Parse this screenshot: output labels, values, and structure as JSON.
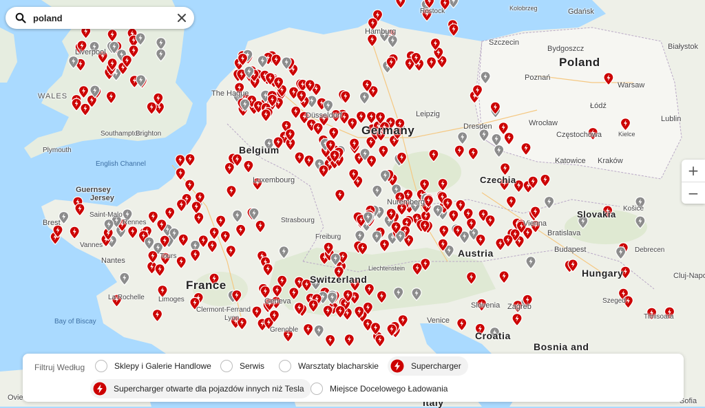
{
  "search": {
    "value": "poland",
    "placeholder": ""
  },
  "map": {
    "zoom_in_label": "+",
    "zoom_out_label": "−",
    "colors": {
      "sea": "#aadaff",
      "land": "#eef0e8",
      "supercharger": "#cc0000",
      "service": "#8c8c8c",
      "highlight_country": "#f6f6f2"
    },
    "labels": {
      "countries": [
        "Poland",
        "Germany",
        "France",
        "Belgium",
        "Czechia",
        "Slovakia",
        "Austria",
        "Hungary",
        "Switzerland",
        "Croatia",
        "Bosnia and",
        "Italy"
      ],
      "regions": [
        "WALES"
      ],
      "seas": [
        "English Channel",
        "Bay of Biscay"
      ],
      "cities": [
        "Liverpool",
        "The Hague",
        "Hamburg",
        "Szczecin",
        "Bydgoszcz",
        "Białystok",
        "Gdańsk",
        "Kolobrzeg",
        "Rostock",
        "Poznań",
        "Warsaw",
        "Łódź",
        "Lublin",
        "Częstochowa",
        "Kielce",
        "Katowice",
        "Kraków",
        "Wrocław",
        "Dresden",
        "Leipzig",
        "Düsseldorf",
        "Southampton",
        "Brighton",
        "Plymouth",
        "Guernsey",
        "Jersey",
        "Luxembourg",
        "Strasbourg",
        "Nuremberg",
        "Bratislava",
        "Budapest",
        "Košice",
        "Debrecen",
        "Cluj-Napoc",
        "Szeged",
        "Timisoara",
        "Zagreb",
        "Venice",
        "Geneva",
        "Grenoble",
        "Limoges",
        "Clermont-Ferrand",
        "La Rochelle",
        "Nantes",
        "Tours",
        "Rennes",
        "Freiburg",
        "Liechtenstein",
        "Lyon",
        "Slovenia",
        "Vienna",
        "Oviedo",
        "Sofia",
        "Brest",
        "Saint-Malo",
        "Vannes"
      ]
    }
  },
  "filter": {
    "title": "Filtruj Według",
    "options": [
      {
        "label": "Sklepy i Galerie Handlowe",
        "selected": false
      },
      {
        "label": "Serwis",
        "selected": false
      },
      {
        "label": "Warsztaty blacharskie",
        "selected": false
      },
      {
        "label": "Supercharger",
        "selected": true
      },
      {
        "label": "Supercharger otwarte dla pojazdów innych niż Tesla",
        "selected": true
      },
      {
        "label": "Miejsce Docelowego Ładowania",
        "selected": false
      }
    ]
  }
}
